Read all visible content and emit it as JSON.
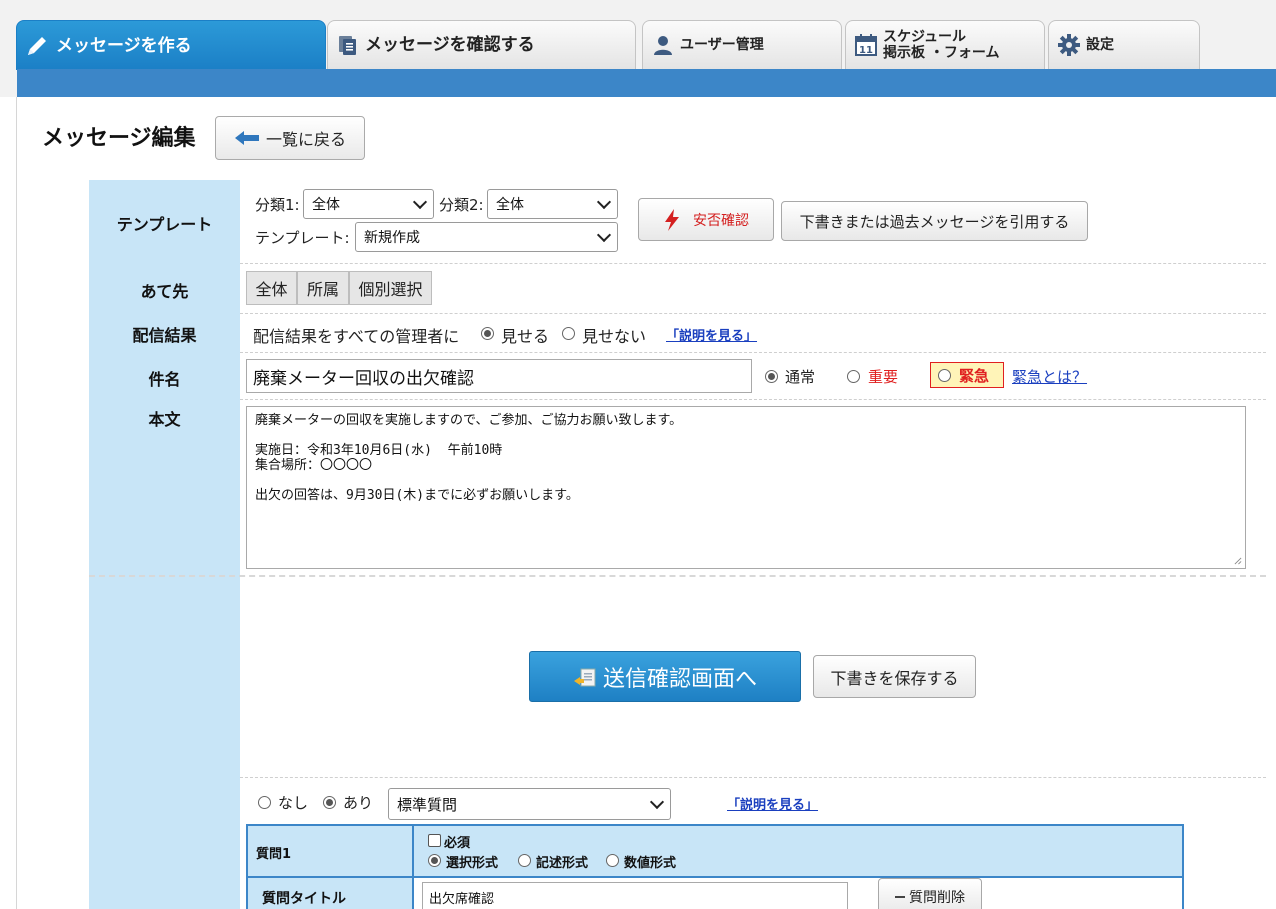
{
  "tabs": [
    {
      "label": "メッセージを作る",
      "icon": "pencil-icon",
      "active": true
    },
    {
      "label": "メッセージを確認する",
      "icon": "documents-icon",
      "active": false
    },
    {
      "label": "ユーザー管理",
      "icon": "user-icon",
      "active": false
    },
    {
      "label_line1": "スケジュール",
      "label_line2": "掲示板 ・フォーム",
      "icon": "calendar-icon",
      "calendar_day": "11",
      "active": false
    },
    {
      "label": "設定",
      "icon": "gear-icon",
      "active": false
    }
  ],
  "page": {
    "title": "メッセージ編集",
    "back_label": "一覧に戻る"
  },
  "template_row": {
    "label": "テンプレート",
    "category1_label": "分類1:",
    "category1_value": "全体",
    "category2_label": "分類2:",
    "category2_value": "全体",
    "template_label": "テンプレート:",
    "template_value": "新規作成",
    "safety_button": "安否確認",
    "quote_button": "下書きまたは過去メッセージを引用する"
  },
  "recipient_row": {
    "label": "あて先",
    "buttons": [
      "全体",
      "所属",
      "個別選択"
    ]
  },
  "result_row": {
    "label": "配信結果",
    "text": "配信結果をすべての管理者に",
    "show": "見せる",
    "hide": "見せない",
    "help_link": "「説明を見る」"
  },
  "subject_row": {
    "label": "件名",
    "value": "廃棄メーター回収の出欠確認",
    "priority_normal": "通常",
    "priority_important": "重要",
    "priority_urgent": "緊急",
    "urgent_link": "緊急とは？"
  },
  "body_row": {
    "label": "本文",
    "value": "廃棄メーターの回収を実施しますので、ご参加、ご協力お願い致します。\n\n実施日：令和3年10月6日(水)  午前10時\n集合場所：〇〇〇〇\n\n出欠の回答は、9月30日(木)までに必ずお願いします。"
  },
  "actions": {
    "send_confirm": "送信確認画面へ",
    "save_draft": "下書きを保存する"
  },
  "question_section": {
    "none_label": "なし",
    "yes_label": "あり",
    "selected": "あり",
    "question_type_value": "標準質問",
    "help_link": "「説明を見る」",
    "question1_label": "質問1",
    "required_label": "必須",
    "format_select": "選択形式",
    "format_text": "記述形式",
    "format_number": "数値形式",
    "title_label": "質問タイトル",
    "title_value": "出欠席確認",
    "delete_button": "質問削除"
  },
  "colors": {
    "accent_blue": "#3c86c8",
    "label_bg": "#c8e5f7",
    "urgent_red": "#e02020",
    "urgent_bg": "#fff4b8"
  }
}
